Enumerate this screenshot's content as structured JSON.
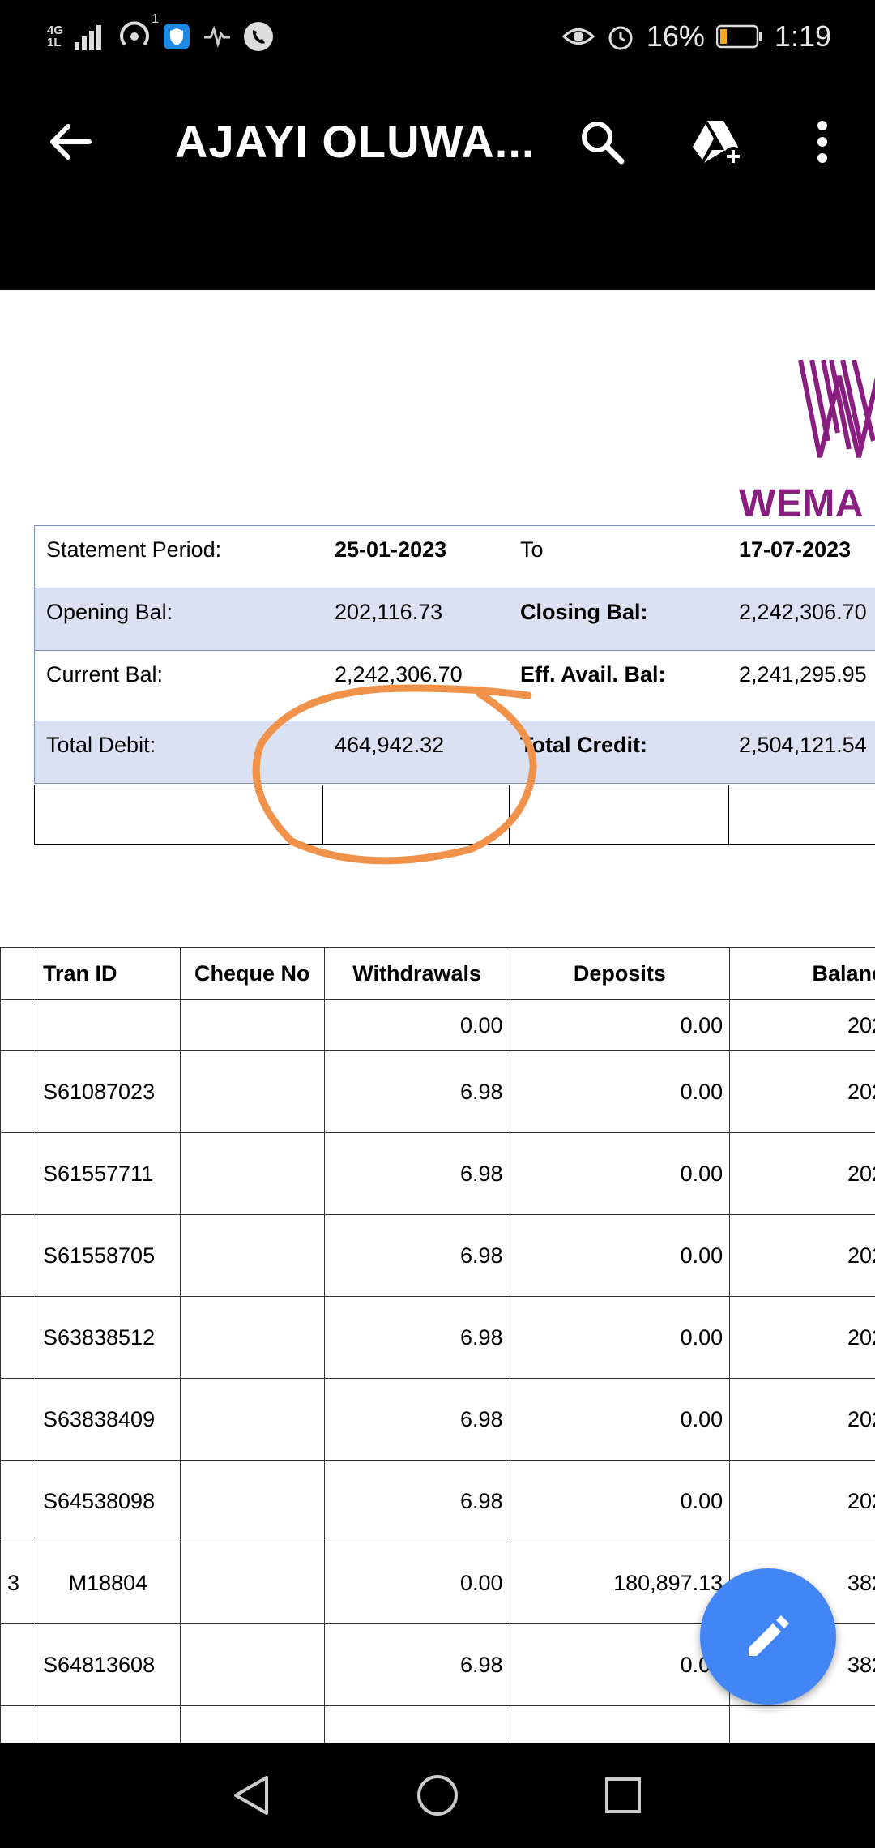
{
  "status_bar": {
    "network_label_top": "4G",
    "network_label_bottom": "1L",
    "wifi_badge": "1",
    "battery_percent": "16%",
    "time": "1:19"
  },
  "app_bar": {
    "title": "AJAYI OLUWA...",
    "icons": [
      "back-arrow-icon",
      "search-icon",
      "drive-add-icon",
      "more-vert-icon"
    ]
  },
  "document": {
    "bank_name": "WEMA B",
    "brand_color": "#8a1e80",
    "summary": [
      {
        "label": "Statement Period:",
        "value": "25-01-2023",
        "label2": "To",
        "value2": "17-07-2023"
      },
      {
        "label": "Opening Bal:",
        "value": "202,116.73",
        "label2": "Closing Bal:",
        "value2": "2,242,306.70"
      },
      {
        "label": "Current Bal:",
        "value": "2,242,306.70",
        "label2": "Eff. Avail. Bal:",
        "value2": "2,241,295.95"
      },
      {
        "label": "Total Debit:",
        "value": "464,942.32",
        "label2": "Total Credit:",
        "value2": "2,504,121.54"
      }
    ],
    "annotation_color": "#f0924a",
    "table": {
      "headers": [
        "Tran ID",
        "Cheque No",
        "Withdrawals",
        "Deposits",
        "Balanc"
      ],
      "rows": [
        {
          "left": "",
          "tran_id": "",
          "cheque": "",
          "withdrawals": "0.00",
          "deposits": "0.00",
          "balance": "202"
        },
        {
          "left": "",
          "tran_id": "S61087023",
          "cheque": "",
          "withdrawals": "6.98",
          "deposits": "0.00",
          "balance": "202"
        },
        {
          "left": "",
          "tran_id": "S61557711",
          "cheque": "",
          "withdrawals": "6.98",
          "deposits": "0.00",
          "balance": "202"
        },
        {
          "left": "",
          "tran_id": "S61558705",
          "cheque": "",
          "withdrawals": "6.98",
          "deposits": "0.00",
          "balance": "202"
        },
        {
          "left": "",
          "tran_id": "S63838512",
          "cheque": "",
          "withdrawals": "6.98",
          "deposits": "0.00",
          "balance": "202"
        },
        {
          "left": "",
          "tran_id": "S63838409",
          "cheque": "",
          "withdrawals": "6.98",
          "deposits": "0.00",
          "balance": "202"
        },
        {
          "left": "",
          "tran_id": "S64538098",
          "cheque": "",
          "withdrawals": "6.98",
          "deposits": "0.00",
          "balance": "202"
        },
        {
          "left": "3",
          "tran_id": "M18804",
          "cheque": "",
          "withdrawals": "0.00",
          "deposits": "180,897.13",
          "balance": "382"
        },
        {
          "left": "",
          "tran_id": "S64813608",
          "cheque": "",
          "withdrawals": "6.98",
          "deposits": "0.00",
          "balance": "382"
        }
      ]
    }
  },
  "fab": {
    "icon": "edit-pencil-icon",
    "color": "#4285f4"
  },
  "nav_bar": {
    "icons": [
      "back-triangle-icon",
      "home-circle-icon",
      "recents-square-icon"
    ]
  }
}
